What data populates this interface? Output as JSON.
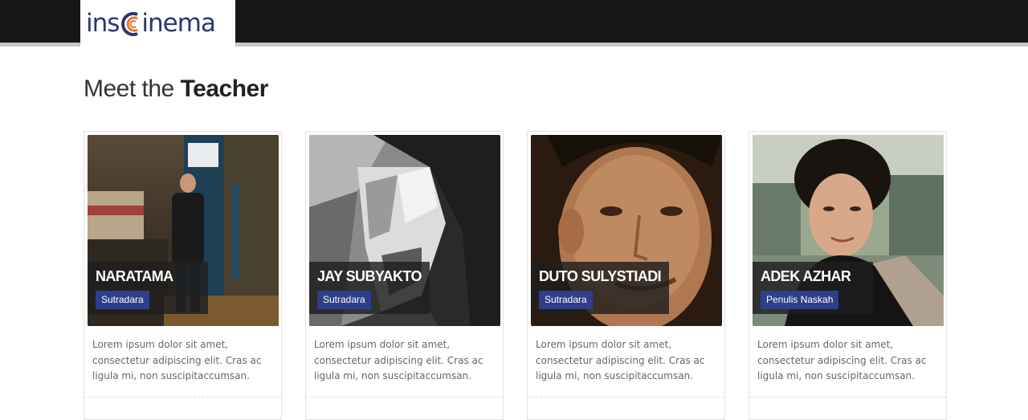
{
  "brand": {
    "logo_text_left": "ins",
    "logo_text_right": "inema"
  },
  "section": {
    "title_light": "Meet the",
    "title_bold": "Teacher"
  },
  "teachers": [
    {
      "name": "NARATAMA",
      "role": "Sutradara",
      "desc": [
        "Lorem ipsum dolor sit amet,",
        "consectetur adipiscing elit. Cras ac",
        "ligula mi, non suscipitaccumsan."
      ]
    },
    {
      "name": "JAY SUBYAKTO",
      "role": "Sutradara",
      "desc": [
        "Lorem ipsum dolor sit amet,",
        "consectetur adipiscing elit. Cras ac",
        "ligula mi, non suscipitaccumsan."
      ]
    },
    {
      "name": "DUTO SULYSTIADI",
      "role": "Sutradara",
      "desc": [
        "Lorem ipsum dolor sit amet,",
        "consectetur adipiscing elit. Cras ac",
        "ligula mi, non suscipitaccumsan."
      ]
    },
    {
      "name": "ADEK AZHAR",
      "role": "Penulis Naskah",
      "desc": [
        "Lorem ipsum dolor sit amet,",
        "consectetur adipiscing elit. Cras ac",
        "ligula mi, non suscipitaccumsan."
      ]
    }
  ],
  "colors": {
    "topbar": "#171717",
    "brand_blue": "#2b3672",
    "accent_orange": "#e8772e",
    "role_badge": "#2f3e8a"
  }
}
